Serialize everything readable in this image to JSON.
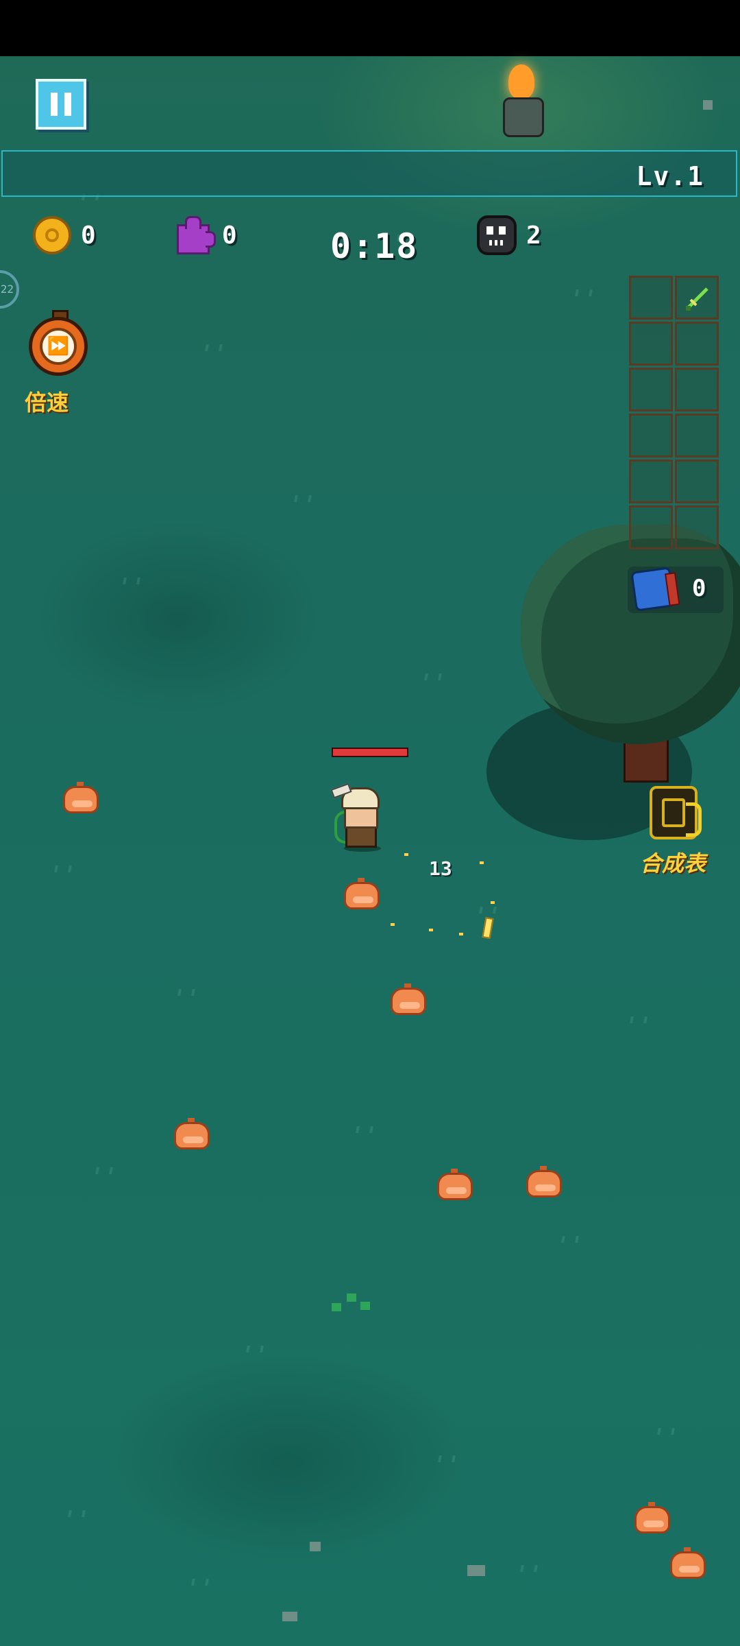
{
  "hud": {
    "level": "Lv.1",
    "coins": "0",
    "puzzle_pieces": "0",
    "timer": "0:18",
    "kills": "2",
    "side_counter": "22",
    "speed_label": "倍速",
    "recipe_label": "合成表",
    "dice_count": "0"
  },
  "combat": {
    "damage_numbers": [
      "13"
    ]
  },
  "icons": {
    "pause": "pause-icon",
    "coin": "coin-icon",
    "puzzle": "puzzle-icon",
    "skull": "skull-icon",
    "speed": "fast-forward-icon",
    "dice": "dice-icon",
    "recipe": "recipe-scroll-icon",
    "weapon": "sword-icon"
  },
  "colors": {
    "field": "#1b6b5e",
    "xp_border": "#2ab7c7",
    "hp_bar": "#e03a3a",
    "accent_gold": "#ffcf3a"
  }
}
